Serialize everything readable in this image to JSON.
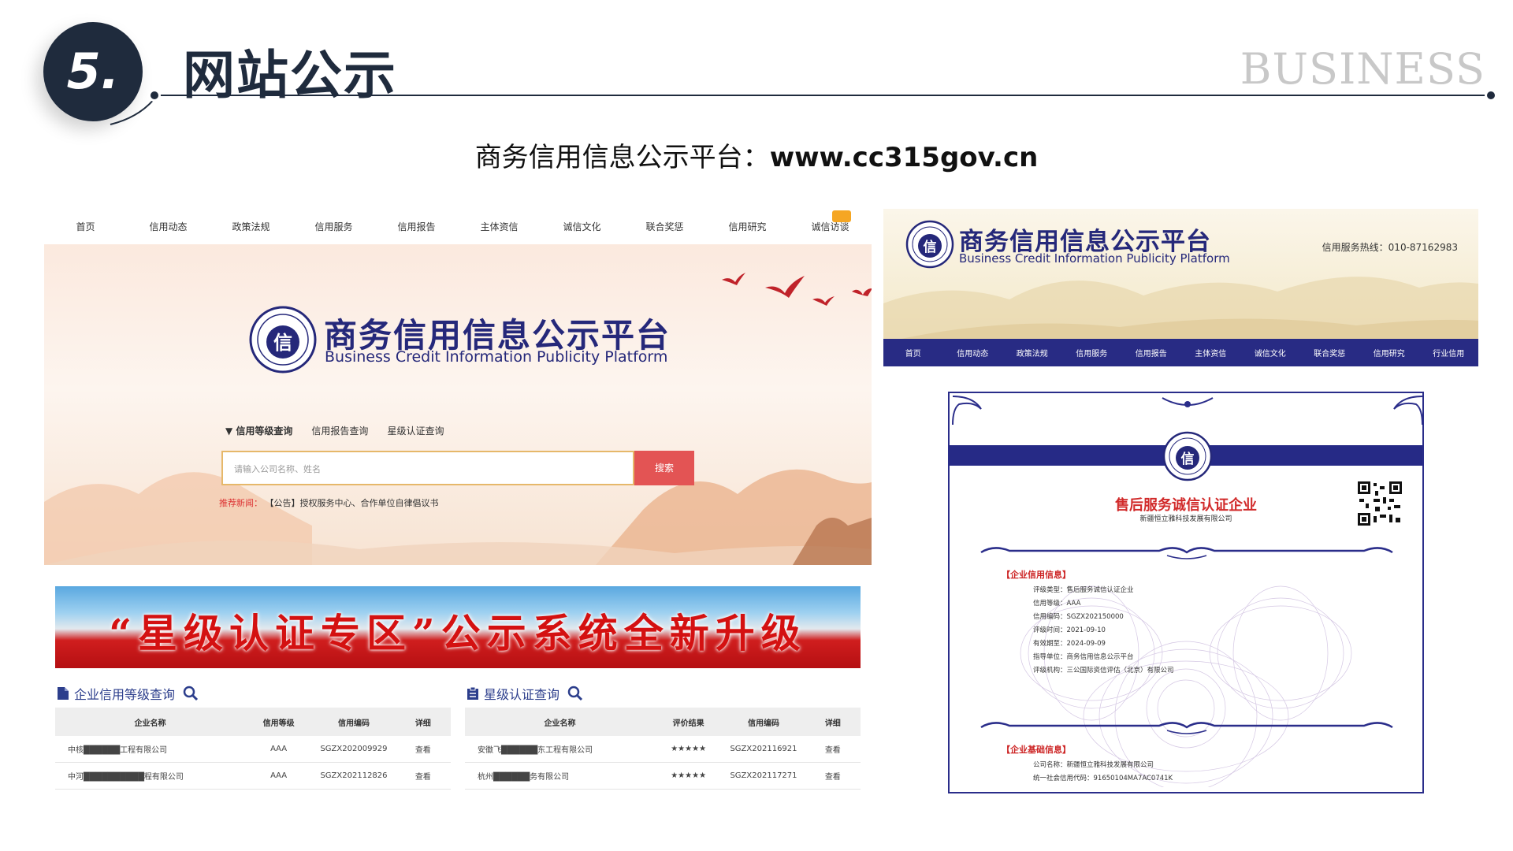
{
  "slide": {
    "number": "5.",
    "title": "网站公示",
    "watermark": "BUSINESS",
    "subtitle_label": "商务信用信息公示平台：",
    "subtitle_url": "www.cc315gov.cn"
  },
  "colors": {
    "navy": "#1f2b3d",
    "brand_blue": "#25287a",
    "nav_bar": "#282b84",
    "search_red": "#e35454",
    "cert_red": "#d12a2a"
  },
  "homepage": {
    "nav": [
      "首页",
      "信用动态",
      "政策法规",
      "信用服务",
      "信用报告",
      "主体资信",
      "诚信文化",
      "联合奖惩",
      "信用研究",
      "诚信访谈"
    ],
    "title_cn": "商务信用信息公示平台",
    "title_en": "Business Credit Information Publicity Platform",
    "query_tabs": [
      "▼ 信用等级查询",
      "信用报告查询",
      "星级认证查询"
    ],
    "search_placeholder": "请输入公司名称、姓名",
    "search_button": "搜索",
    "news_label": "推荐新闻：",
    "news_text": "【公告】授权服务中心、合作单位自律倡议书"
  },
  "header_shot": {
    "title_cn": "商务信用信息公示平台",
    "title_en": "Business Credit Information Publicity Platform",
    "hotline": "信用服务热线：010-87162983",
    "nav": [
      "首页",
      "信用动态",
      "政策法规",
      "信用服务",
      "信用报告",
      "主体资信",
      "诚信文化",
      "联合奖惩",
      "信用研究",
      "行业信用"
    ]
  },
  "banner": {
    "text": "“星级认证专区”公示系统全新升级"
  },
  "tables": {
    "credit": {
      "title": "企业信用等级查询",
      "icon": "document-icon",
      "columns": [
        "企业名称",
        "信用等级",
        "信用编码",
        "详细"
      ],
      "rows": [
        [
          "中核██████工程有限公司",
          "AAA",
          "SGZX202009929",
          "查看"
        ],
        [
          "中河██████████程有限公司",
          "AAA",
          "SGZX202112826",
          "查看"
        ]
      ]
    },
    "star": {
      "title": "星级认证查询",
      "icon": "clipboard-icon",
      "columns": [
        "企业名称",
        "评价结果",
        "信用编码",
        "详细"
      ],
      "rows": [
        [
          "安徽飞██████东工程有限公司",
          "★★★★★",
          "SGZX202116921",
          "查看"
        ],
        [
          "杭州██████务有限公司",
          "★★★★★",
          "SGZX202117271",
          "查看"
        ]
      ]
    }
  },
  "certificate": {
    "title": "售后服务诚信认证企业",
    "company": "新疆恒立雅科技发展有限公司",
    "section1": "【企业信用信息】",
    "info1": [
      "评级类型：售后服务诚信认证企业",
      "信用等级：AAA",
      "信用编码：SGZX202150000",
      "评级时间：2021-09-10",
      "有效期至：2024-09-09",
      "指导单位：商务信用信息公示平台",
      "评级机构：三公国际资信评估（北京）有限公司"
    ],
    "section2": "【企业基础信息】",
    "info2": [
      "公司名称：新疆恒立雅科技发展有限公司",
      "统一社会信用代码：91650104MA7AC0741K"
    ]
  }
}
